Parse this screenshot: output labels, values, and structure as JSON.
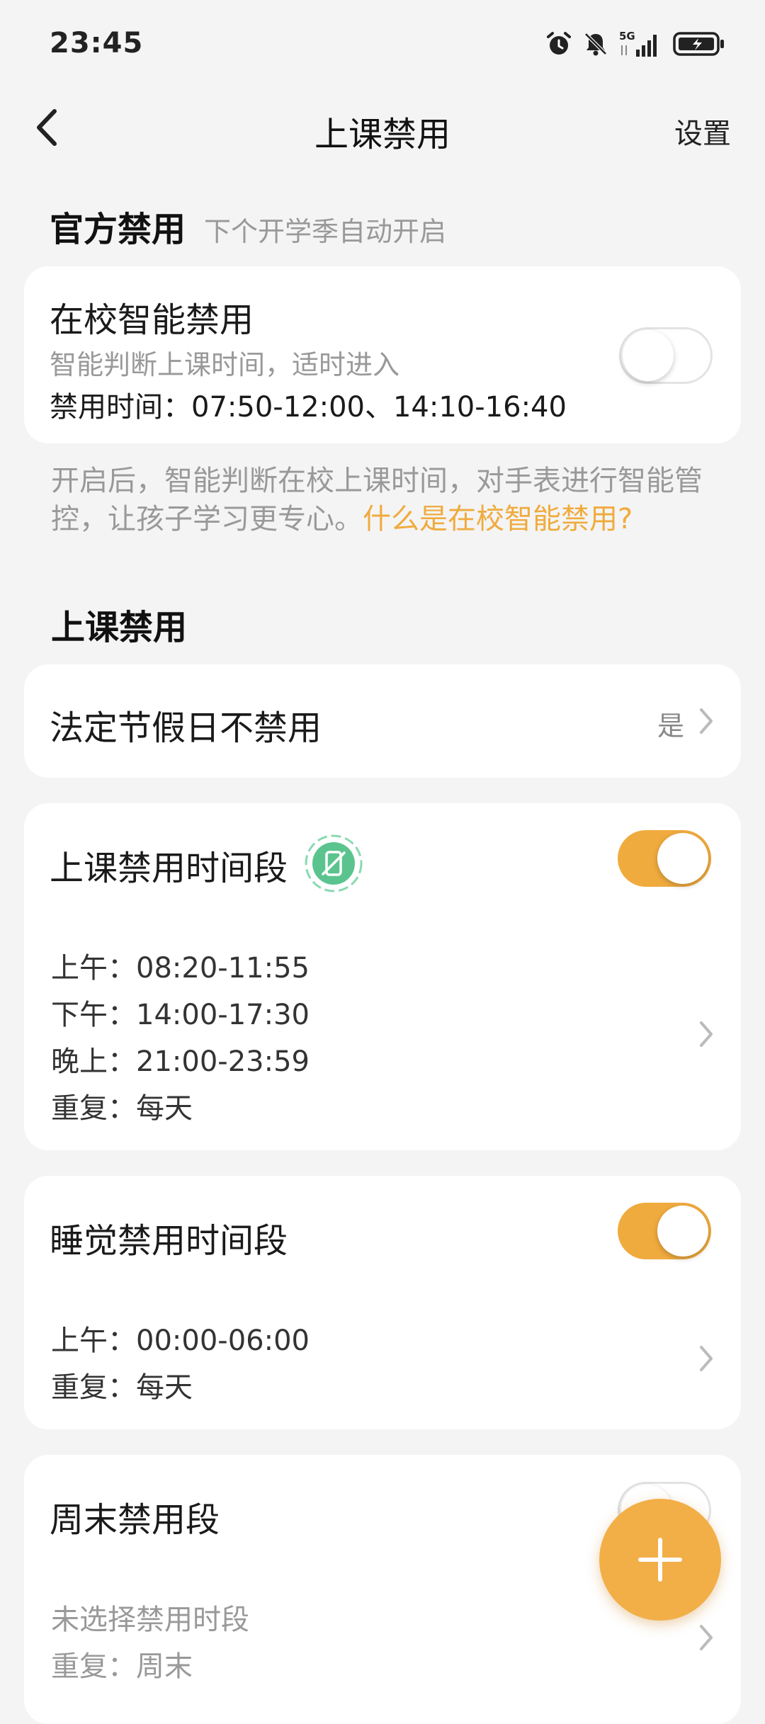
{
  "status": {
    "time": "23:45",
    "network": "5G",
    "icons": [
      "alarm-icon",
      "bell-off-icon",
      "signal-5g-icon",
      "battery-charging-icon"
    ]
  },
  "nav": {
    "title": "上课禁用",
    "settings": "设置",
    "back_icon": "chevron-left-icon"
  },
  "official": {
    "heading": "官方禁用",
    "subheading": "下个开学季自动开启",
    "card": {
      "title": "在校智能禁用",
      "desc": "智能判断上课时间，适时进入",
      "time": "禁用时间：07:50-12:00、14:10-16:40",
      "enabled": false
    },
    "note": "开启后，智能判断在校上课时间，对手表进行智能管控，让孩子学习更专心。",
    "note_link": "什么是在校智能禁用?"
  },
  "class_section": {
    "heading": "上课禁用",
    "holiday": {
      "label": "法定节假日不禁用",
      "value": "是"
    },
    "periods": [
      {
        "title": "上课禁用时间段",
        "enabled": true,
        "badge_icon": "phone-disabled-icon",
        "lines": [
          "上午：08:20-11:55",
          "下午：14:00-17:30",
          "晚上：21:00-23:59",
          "重复：每天"
        ]
      },
      {
        "title": "睡觉禁用时间段",
        "enabled": true,
        "lines": [
          "上午：00:00-06:00",
          "重复：每天"
        ]
      },
      {
        "title": "周末禁用段",
        "enabled": false,
        "lines": [
          "未选择禁用时段",
          "重复：周末"
        ]
      }
    ]
  },
  "fab": {
    "icon": "plus-icon"
  },
  "colors": {
    "accent": "#F0AB3E",
    "badge": "#5BC48E",
    "background": "#F4F4F4"
  }
}
